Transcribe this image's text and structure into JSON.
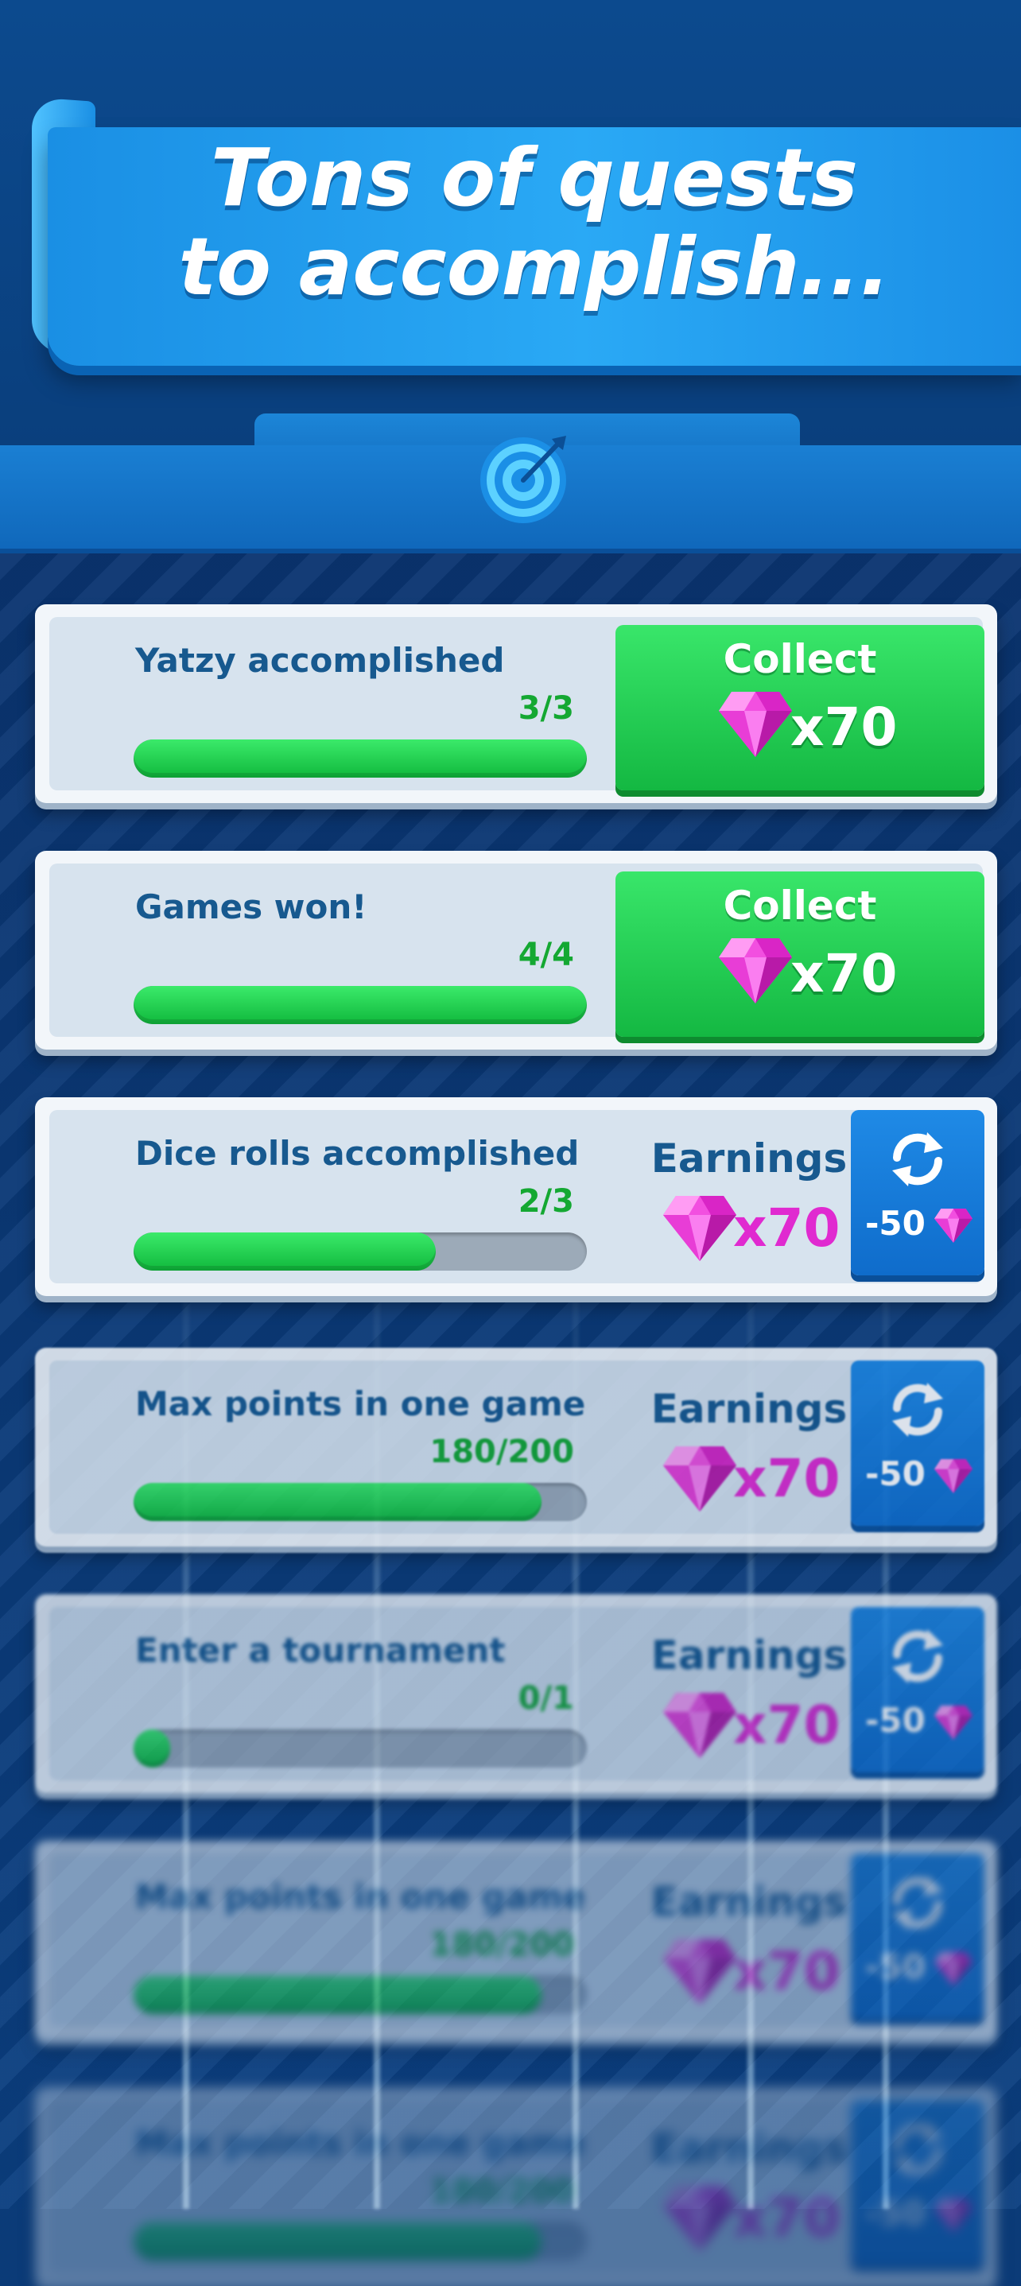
{
  "banner": {
    "line1": "Tons of quests",
    "line2": "to accomplish..."
  },
  "header": {
    "icon": "target-icon"
  },
  "colors": {
    "green": "#14b842",
    "blue": "#1570c2",
    "gem": "#e02ad0",
    "progress": "#14a832"
  },
  "quests": [
    {
      "title": "Yatzy accomplished",
      "progress_text": "3/3",
      "progress": 1.0,
      "action": "collect",
      "collect_label": "Collect",
      "reward": "x70"
    },
    {
      "title": "Games won!",
      "progress_text": "4/4",
      "progress": 1.0,
      "action": "collect",
      "collect_label": "Collect",
      "reward": "x70"
    },
    {
      "title": "Dice rolls accomplished",
      "progress_text": "2/3",
      "progress": 0.667,
      "action": "earnings",
      "earn_label": "Earnings",
      "reward": "x70",
      "refresh_cost": "-50"
    },
    {
      "title": "Max points in one game",
      "progress_text": "180/200",
      "progress": 0.9,
      "action": "earnings",
      "earn_label": "Earnings",
      "reward": "x70",
      "refresh_cost": "-50"
    },
    {
      "title": "Enter a tournament",
      "progress_text": "0/1",
      "progress": 0.08,
      "action": "earnings",
      "earn_label": "Earnings",
      "reward": "x70",
      "refresh_cost": "-50"
    },
    {
      "title": "Max points in one game",
      "progress_text": "180/200",
      "progress": 0.9,
      "action": "earnings",
      "earn_label": "Earnings",
      "reward": "x70",
      "refresh_cost": "-50"
    },
    {
      "title": "Max points in one game",
      "progress_text": "180/200",
      "progress": 0.9,
      "action": "earnings",
      "earn_label": "Earnings",
      "reward": "x70",
      "refresh_cost": "-50"
    }
  ]
}
